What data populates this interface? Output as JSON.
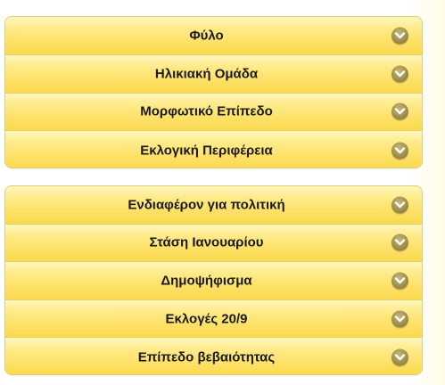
{
  "groups": [
    {
      "items": [
        {
          "label": "Φύλο",
          "icon": "chevron-down-icon"
        },
        {
          "label": "Ηλικιακή Ομάδα",
          "icon": "chevron-down-icon"
        },
        {
          "label": "Μορφωτικό Επίπεδο",
          "icon": "chevron-down-icon"
        },
        {
          "label": "Εκλογική Περιφέρεια",
          "icon": "chevron-down-icon"
        }
      ]
    },
    {
      "items": [
        {
          "label": "Ενδιαφέρον για πολιτική",
          "icon": "chevron-down-icon"
        },
        {
          "label": "Στάση Ιανουαρίου",
          "icon": "chevron-down-icon"
        },
        {
          "label": "Δημοψήφισμα",
          "icon": "chevron-down-icon"
        },
        {
          "label": "Εκλογές 20/9",
          "icon": "chevron-down-icon"
        },
        {
          "label": "Επίπεδο βεβαιότητας",
          "icon": "chevron-down-icon"
        }
      ]
    }
  ],
  "colors": {
    "row_top": "#fff6bf",
    "row_bottom": "#fbd94f",
    "border": "#e2cf6a",
    "chevron_bg": "#9c8c4a",
    "text": "#1a1a1a"
  }
}
